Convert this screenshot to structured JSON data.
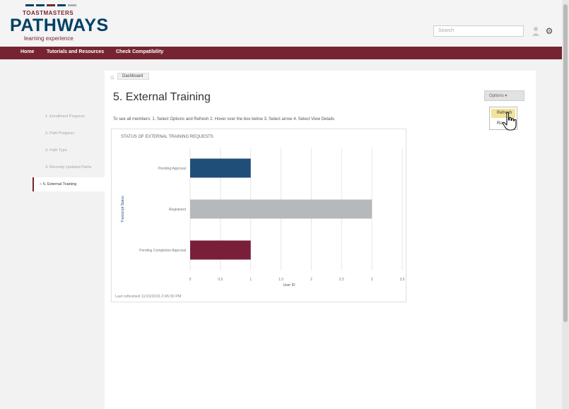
{
  "header": {
    "logo_top": "TOASTMASTERS",
    "logo_main": "PATHWAYS",
    "logo_sub": "learning experience",
    "search_placeholder": "Search"
  },
  "nav": {
    "items": [
      "Home",
      "Tutorials and Resources",
      "Check Compatibility"
    ]
  },
  "breadcrumb": {
    "label": "Dashboard"
  },
  "page": {
    "title": "5. External Training",
    "instructions": "To see all members: 1. Select Options and Refresh 2. Hover over the box below 3. Select arrow 4. Select View Details",
    "options_label": "Options",
    "dropdown": [
      "Refresh",
      "Ro..."
    ]
  },
  "sidebar": {
    "items": [
      "1. Enrollment Progress",
      "2. Path Progress",
      "3. Path Type",
      "4. Recently Updated Paths",
      "5. External Training"
    ],
    "active_index": 4
  },
  "chart_data": {
    "type": "bar",
    "orientation": "horizontal",
    "title": "STATUS OF EXTERNAL TRAINING REQUESTS",
    "categories": [
      "Pending Approval",
      "Registered",
      "Pending Completion Approval"
    ],
    "values": [
      1,
      3,
      1
    ],
    "colors": [
      "#1f4e79",
      "#b5b9bb",
      "#7a1f3a"
    ],
    "xlabel": "User ID",
    "ylabel": "Transcript Status",
    "xlim": [
      0,
      3.5
    ],
    "xticks": [
      "0",
      "0.5",
      "1",
      "1.5",
      "2",
      "2.5",
      "3",
      "3.5"
    ],
    "grid": true,
    "refreshed_text": "Last refreshed 11/10/2016 2:45:00 PM"
  },
  "colors": {
    "brand_maroon": "#772432",
    "brand_blue": "#004165",
    "highlight": "#f2e39a"
  }
}
